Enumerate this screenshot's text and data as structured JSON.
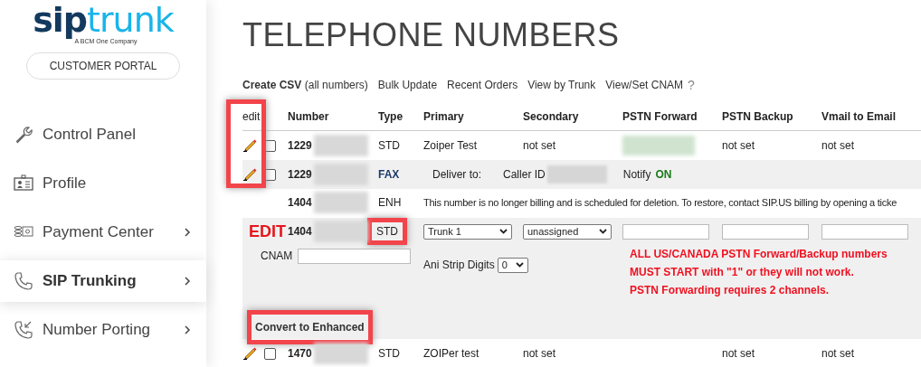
{
  "sidebar": {
    "logo": {
      "part_1": "sip",
      "part_2": "trunk",
      "tagline": "A BCM One Company"
    },
    "portal_button": "CUSTOMER PORTAL",
    "items": [
      {
        "label": "Control Panel",
        "selected": false,
        "has_submenu": false
      },
      {
        "label": "Profile",
        "selected": false,
        "has_submenu": false
      },
      {
        "label": "Payment Center",
        "selected": false,
        "has_submenu": true
      },
      {
        "label": "SIP Trunking",
        "selected": true,
        "has_submenu": true
      },
      {
        "label": "Number Porting",
        "selected": false,
        "has_submenu": true
      }
    ]
  },
  "page_title": "TELEPHONE NUMBERS",
  "links": [
    {
      "label": "**Create CSV** (all numbers)"
    },
    {
      "label": "Bulk Update"
    },
    {
      "label": "Recent Orders"
    },
    {
      "label": "View by Trunk"
    },
    {
      "label": "View/Set CNAM"
    }
  ],
  "help": "?",
  "table": {
    "edit_column_highlighted": true,
    "columns": [
      "edit",
      "Number",
      "Type",
      "Primary",
      "Secondary",
      "PSTN Forward",
      "PSTN Backup",
      "Vmail to Email"
    ],
    "rows": [
      {
        "kind": "standard",
        "editable": true,
        "checked": false,
        "number": "1229",
        "type": "STD",
        "primary": "Zoiper Test",
        "secondary": "not set",
        "pstn_backup": "not set",
        "vmail": "not set"
      },
      {
        "kind": "fax",
        "editable": true,
        "checked": false,
        "number": "1229",
        "type": "FAX",
        "deliver_label": "Deliver to:",
        "caller_id_label": "Caller ID",
        "notify_label": "Notify",
        "notify": "ON"
      },
      {
        "kind": "notice",
        "editable": false,
        "number": "1404",
        "type": "ENH",
        "message": "This number is no longer billing and is scheduled for deletion. To restore, contact SIP.US billing by opening a ticke"
      },
      {
        "kind": "edit",
        "edit_label": "EDIT",
        "number": "1404",
        "type": "STD",
        "type_highlighted": true,
        "primary": "Trunk 1",
        "secondary": "unassigned",
        "cnam_label": "CNAM",
        "ani_label": "Ani Strip Digits",
        "ani_value": "0",
        "notes": [
          "ALL US/CANADA PSTN Forward/Backup numbers",
          "MUST START with \"1\" or they will not work.",
          "PSTN Forwarding requires 2 channels."
        ],
        "convert_button": {
          "label": "Convert to Enhanced",
          "highlighted": true
        }
      },
      {
        "kind": "standard",
        "editable": true,
        "checked": false,
        "number": "1470",
        "type": "STD",
        "primary": "ZOIPer test",
        "secondary": "not set",
        "pstn_backup": "not set",
        "vmail": "not set"
      }
    ]
  }
}
